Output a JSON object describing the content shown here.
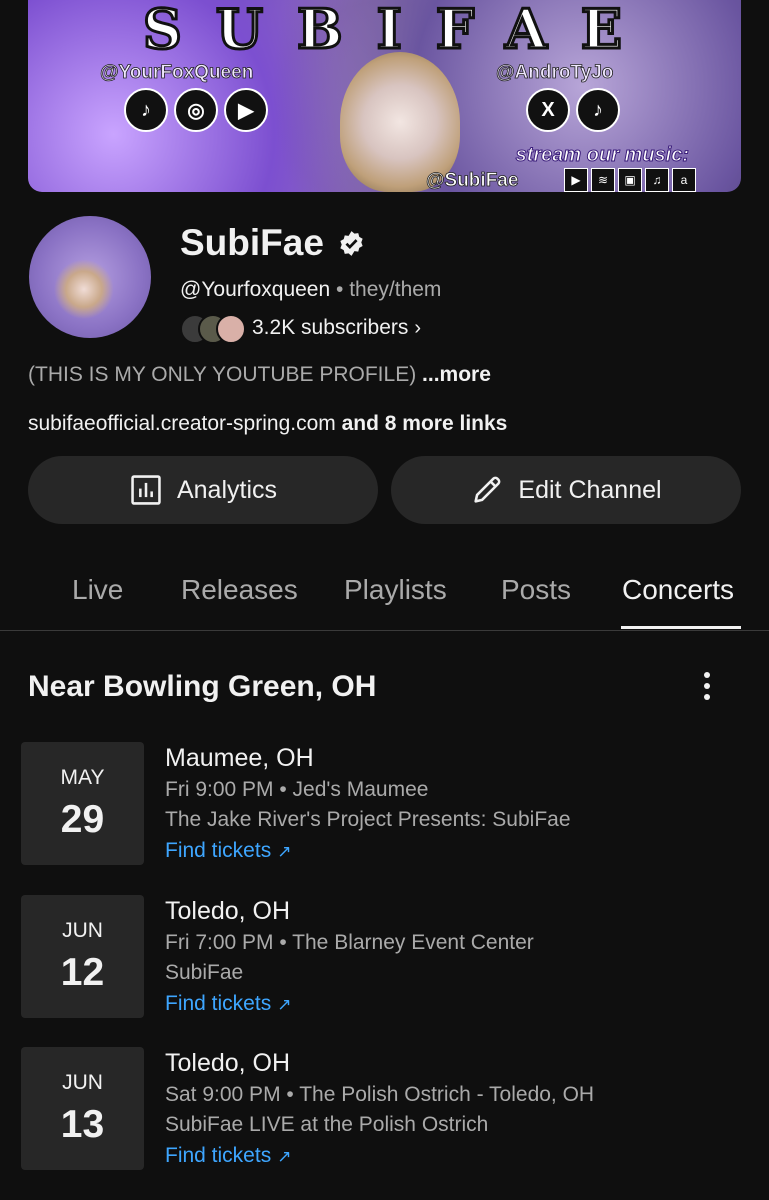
{
  "banner": {
    "title": "SUBIFAE",
    "handle_left": "@YourFoxQueen",
    "handle_right": "@AndroTyJo",
    "stream_text": "stream our music:",
    "stream_handle": "@SubiFae"
  },
  "channel": {
    "name": "SubiFae",
    "handle": "@Yourfoxqueen",
    "pronouns": "they/them",
    "subscribers": "3.2K subscribers",
    "description": "(THIS IS MY ONLY YOUTUBE PROFILE)",
    "description_more": "...more",
    "link_primary": "subifaeofficial.creator-spring.com",
    "link_more": "and 8 more links"
  },
  "actions": {
    "analytics_label": "Analytics",
    "edit_label": "Edit Channel"
  },
  "tabs": [
    {
      "label": "Live"
    },
    {
      "label": "Releases"
    },
    {
      "label": "Playlists"
    },
    {
      "label": "Posts"
    },
    {
      "label": "Concerts"
    }
  ],
  "active_tab": "Concerts",
  "concerts": {
    "section_title": "Near Bowling Green, OH",
    "events": [
      {
        "month": "MAY",
        "day": "29",
        "city": "Maumee, OH",
        "when": "Fri 9:00 PM • Jed's Maumee",
        "title": "The Jake River's Project Presents: SubiFae",
        "tickets_label": "Find tickets"
      },
      {
        "month": "JUN",
        "day": "12",
        "city": "Toledo, OH",
        "when": "Fri 7:00 PM • The Blarney Event Center",
        "title": "SubiFae",
        "tickets_label": "Find tickets"
      },
      {
        "month": "JUN",
        "day": "13",
        "city": "Toledo, OH",
        "when": "Sat 9:00 PM • The Polish Ostrich - Toledo, OH",
        "title": "SubiFae LIVE at the Polish Ostrich",
        "tickets_label": "Find tickets"
      }
    ]
  },
  "colors": {
    "background": "#0f0f0f",
    "button": "#272727",
    "link": "#3ea6ff",
    "secondary_text": "#aaaaaa"
  },
  "icons": [
    "tiktok-icon",
    "instagram-icon",
    "youtube-icon",
    "x-icon",
    "verified-badge-icon",
    "analytics-icon",
    "pencil-icon",
    "chevron-right-icon",
    "kebab-menu-icon",
    "external-arrow-icon"
  ]
}
